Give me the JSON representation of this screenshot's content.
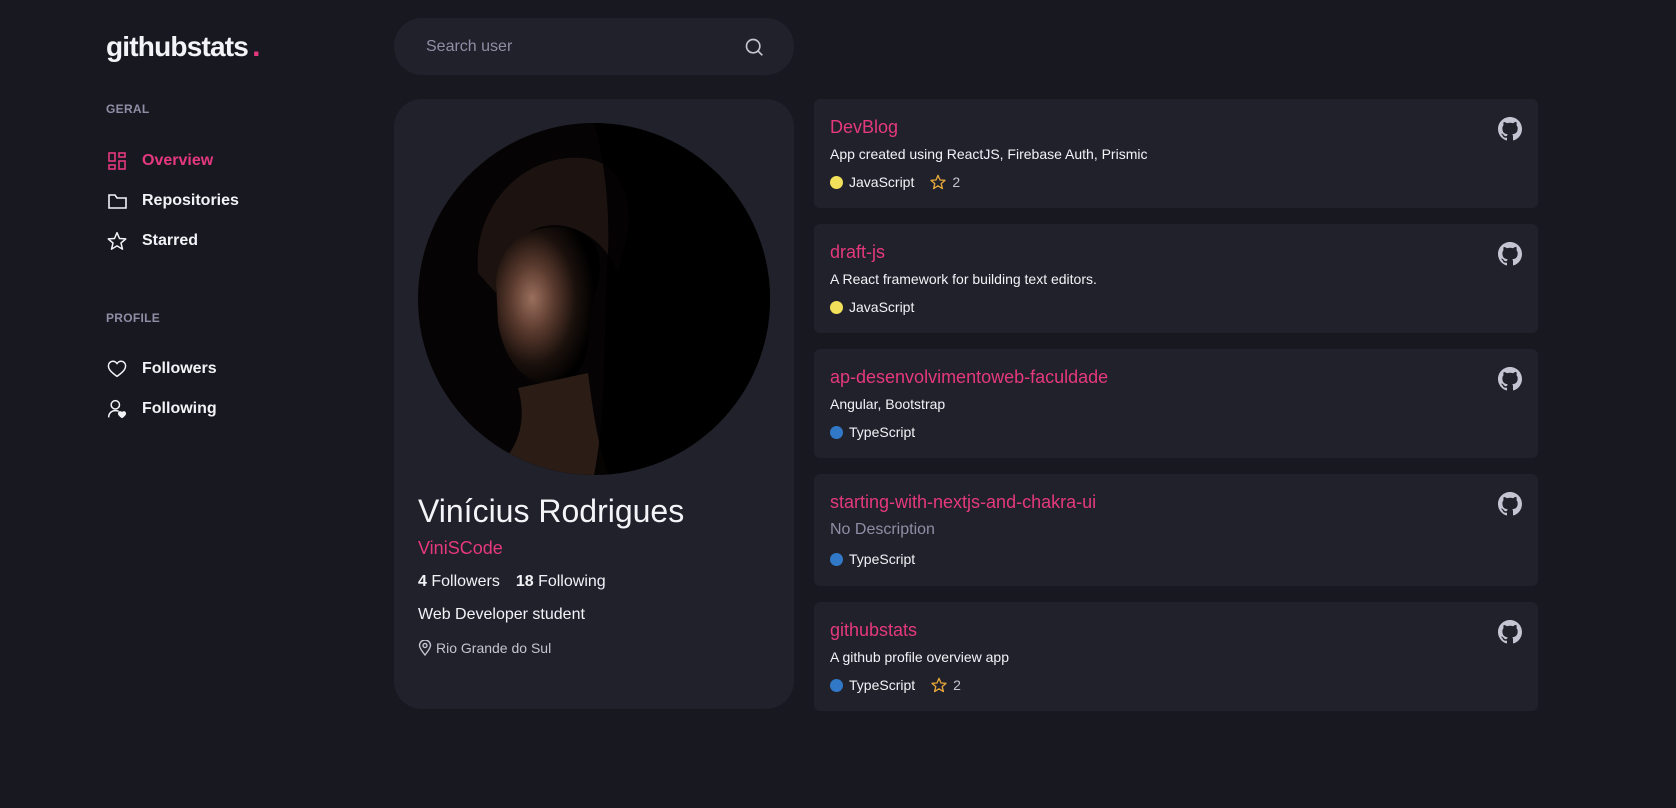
{
  "app": {
    "logo_text": "githubstats",
    "logo_dot": ".",
    "accent": "#e5387f"
  },
  "sidebar": {
    "sections": [
      {
        "label": "GERAL",
        "items": [
          {
            "label": "Overview",
            "icon": "dashboard-icon",
            "active": true
          },
          {
            "label": "Repositories",
            "icon": "folder-icon",
            "active": false
          },
          {
            "label": "Starred",
            "icon": "star-icon",
            "active": false
          }
        ]
      },
      {
        "label": "PROFILE",
        "items": [
          {
            "label": "Followers",
            "icon": "heart-icon",
            "active": false
          },
          {
            "label": "Following",
            "icon": "user-heart-icon",
            "active": false
          }
        ]
      }
    ]
  },
  "search": {
    "placeholder": "Search user",
    "value": "",
    "icon": "search-icon"
  },
  "profile": {
    "name": "Vinícius Rodrigues",
    "login": "ViniSCode",
    "followers_count": "4",
    "followers_label": "Followers",
    "following_count": "18",
    "following_label": "Following",
    "bio": "Web Developer student",
    "location": "Rio Grande do Sul"
  },
  "repos": [
    {
      "name": "DevBlog",
      "description": "App created using ReactJS, Firebase Auth, Prismic",
      "language": "JavaScript",
      "lang_color": "#f1e05a",
      "stars": "2"
    },
    {
      "name": "draft-js",
      "description": "A React framework for building text editors.",
      "language": "JavaScript",
      "lang_color": "#f1e05a",
      "stars": null
    },
    {
      "name": "ap-desenvolvimentoweb-faculdade",
      "description": "Angular, Bootstrap",
      "language": "TypeScript",
      "lang_color": "#3178c6",
      "stars": null
    },
    {
      "name": "starting-with-nextjs-and-chakra-ui",
      "description": "No Description",
      "description_muted": true,
      "language": "TypeScript",
      "lang_color": "#3178c6",
      "stars": null
    },
    {
      "name": "githubstats",
      "description": "A github profile overview app",
      "language": "TypeScript",
      "lang_color": "#3178c6",
      "stars": "2"
    }
  ]
}
